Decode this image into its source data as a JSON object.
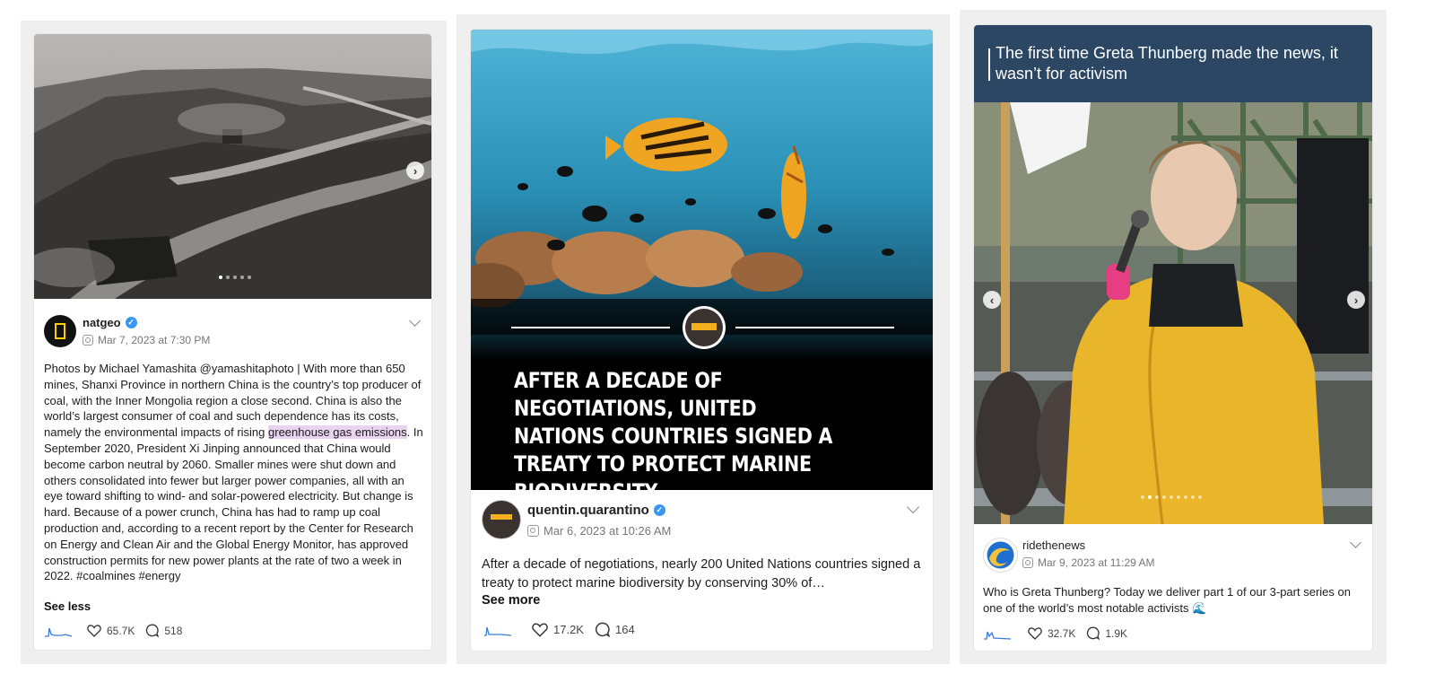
{
  "posts": [
    {
      "username": "natgeo",
      "verified": true,
      "date": "Mar 7, 2023 at 7:30 PM",
      "caption_before": "Photos by Michael Yamashita @yamashitaphoto | With more than 650 mines, Shanxi Province in northern China is the country’s top producer of coal, with the Inner Mongolia region a close second. China is also the world’s largest consumer of coal and such dependence has its costs, namely the environmental impacts of rising ",
      "caption_highlight": "greenhouse gas emissions",
      "caption_after": ". In September 2020, President Xi Jinping announced that China would become carbon neutral by 2060. Smaller mines were shut down and others consolidated into fewer but larger power companies, all with an eye toward shifting to wind- and solar-powered electricity. But change is hard. Because of a power crunch, China has had to ramp up coal production and, according to a recent report by the Center for Research on Energy and Clean Air and the Global Energy Monitor, has approved construction permits for new power plants at the rate of two a week in 2022. #coalmines #energy",
      "toggle_label": "See less",
      "likes": "65.7K",
      "comments": "518",
      "next_glyph": "›"
    },
    {
      "username": "quentin.quarantino",
      "verified": true,
      "date": "Mar 6, 2023 at 10:26 AM",
      "headline": "AFTER A DECADE OF NEGOTIATIONS, UNITED NATIONS COUNTRIES SIGNED A TREATY TO PROTECT MARINE BIODIVERSITY",
      "caption": "After a decade of negotiations, nearly 200 United Nations countries signed a treaty to protect marine biodiversity by conserving 30% of…",
      "toggle_label": "See more",
      "likes": "17.2K",
      "comments": "164"
    },
    {
      "username": "ridethenews",
      "verified": false,
      "date": "Mar 9, 2023 at 11:29 AM",
      "banner": "The first time Greta Thunberg made the news, it wasn’t for activism",
      "caption": "Who is Greta Thunberg? Today we deliver part 1 of our 3-part series on one of the world’s most notable activists 🌊",
      "likes": "32.7K",
      "comments": "1.9K",
      "prev_glyph": "‹",
      "next_glyph": "›"
    }
  ],
  "colors": {
    "panel_bg": "#efefef",
    "verified_blue": "#3897f0",
    "highlight": "#ead3f0",
    "banner_navy": "#2b4763",
    "ocean_blue": "#2a8fb5",
    "coat_yellow": "#e9b52a"
  }
}
